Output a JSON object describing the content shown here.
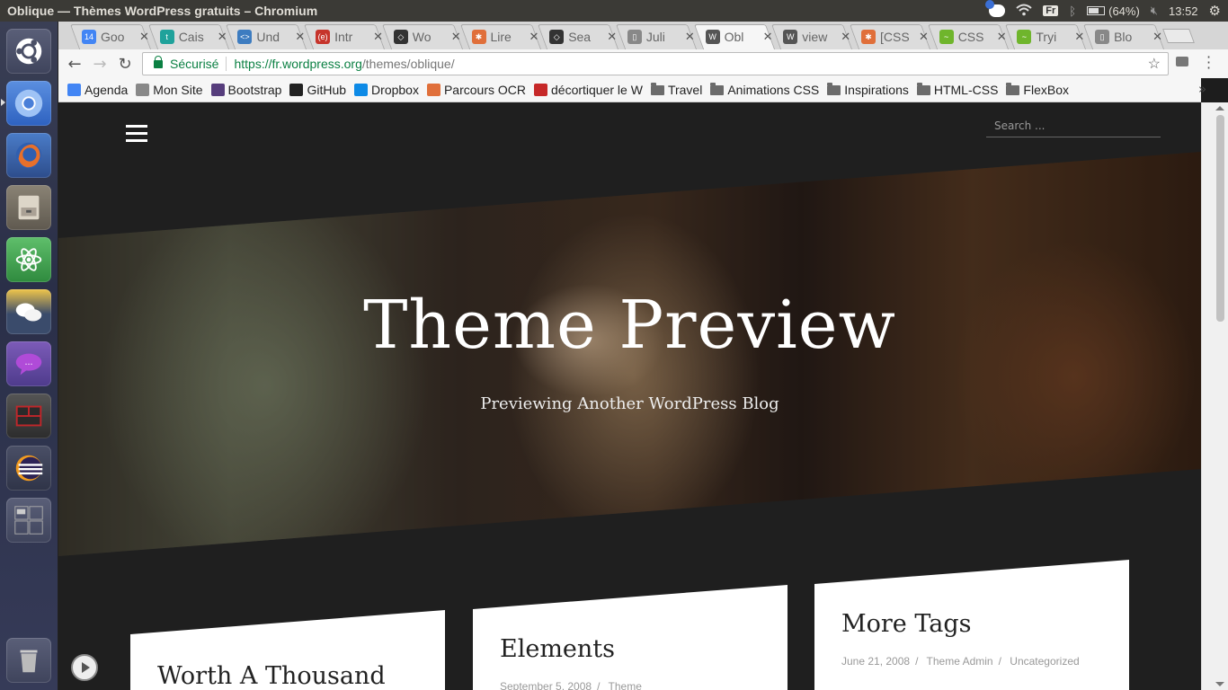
{
  "system": {
    "window_title": "Oblique — Thèmes WordPress gratuits – Chromium",
    "keyboard": "Fr",
    "battery": "(64%)",
    "clock": "13:52"
  },
  "tabs": [
    {
      "label": "Goo",
      "fav_text": "14",
      "fav_color": "#4285f4"
    },
    {
      "label": "Cais",
      "fav_text": "t",
      "fav_color": "#1fa29b"
    },
    {
      "label": "Und",
      "fav_text": "<>",
      "fav_color": "#3d7cc0"
    },
    {
      "label": "Intr",
      "fav_text": "(e)",
      "fav_color": "#c6342b"
    },
    {
      "label": "Wo",
      "fav_text": "◇",
      "fav_color": "#333333"
    },
    {
      "label": "Lire",
      "fav_text": "✱",
      "fav_color": "#e06f3a"
    },
    {
      "label": "Sea",
      "fav_text": "◇",
      "fav_color": "#333333"
    },
    {
      "label": "Juli",
      "fav_text": "▯",
      "fav_color": "#888888"
    },
    {
      "label": "Obl",
      "fav_text": "W",
      "fav_color": "#555555"
    },
    {
      "label": "view",
      "fav_text": "W",
      "fav_color": "#555555"
    },
    {
      "label": "[CSS",
      "fav_text": "✱",
      "fav_color": "#e06f3a"
    },
    {
      "label": "CSS",
      "fav_text": "~",
      "fav_color": "#6fb52c"
    },
    {
      "label": "Tryi",
      "fav_text": "~",
      "fav_color": "#6fb52c"
    },
    {
      "label": "Blo",
      "fav_text": "▯",
      "fav_color": "#888888"
    }
  ],
  "address": {
    "secure_label": "Sécurisé",
    "url_host": "https://fr.wordpress.org",
    "url_path": "/themes/oblique/"
  },
  "bookmarks": [
    {
      "label": "Agenda",
      "icon": "calendar-icon",
      "color": "#4285f4"
    },
    {
      "label": "Mon Site",
      "icon": "page-icon",
      "color": "#888888"
    },
    {
      "label": "Bootstrap",
      "icon": "bootstrap-icon",
      "color": "#563d7c"
    },
    {
      "label": "GitHub",
      "icon": "github-icon",
      "color": "#222222"
    },
    {
      "label": "Dropbox",
      "icon": "dropbox-icon",
      "color": "#0d8ae6"
    },
    {
      "label": "Parcours OCR",
      "icon": "ocr-icon",
      "color": "#e06f3a"
    },
    {
      "label": "décortiquer le W",
      "icon": "w-icon",
      "color": "#c62828"
    },
    {
      "label": "Travel",
      "icon": "folder-icon",
      "color": "#6b6b6b"
    },
    {
      "label": "Animations CSS",
      "icon": "folder-icon",
      "color": "#6b6b6b"
    },
    {
      "label": "Inspirations",
      "icon": "folder-icon",
      "color": "#6b6b6b"
    },
    {
      "label": "HTML-CSS",
      "icon": "folder-icon",
      "color": "#6b6b6b"
    },
    {
      "label": "FlexBox",
      "icon": "folder-icon",
      "color": "#6b6b6b"
    }
  ],
  "page": {
    "search_placeholder": "Search ...",
    "hero_title": "Theme Preview",
    "hero_subtitle": "Previewing Another WordPress Blog",
    "posts": [
      {
        "title": "Worth A Thousand",
        "date": "",
        "author": "",
        "category": ""
      },
      {
        "title": "Elements",
        "date": "September 5, 2008",
        "author": "Theme",
        "category": ""
      },
      {
        "title": "More Tags",
        "date": "June 21, 2008",
        "author": "Theme Admin",
        "category": "Uncategorized"
      }
    ]
  }
}
